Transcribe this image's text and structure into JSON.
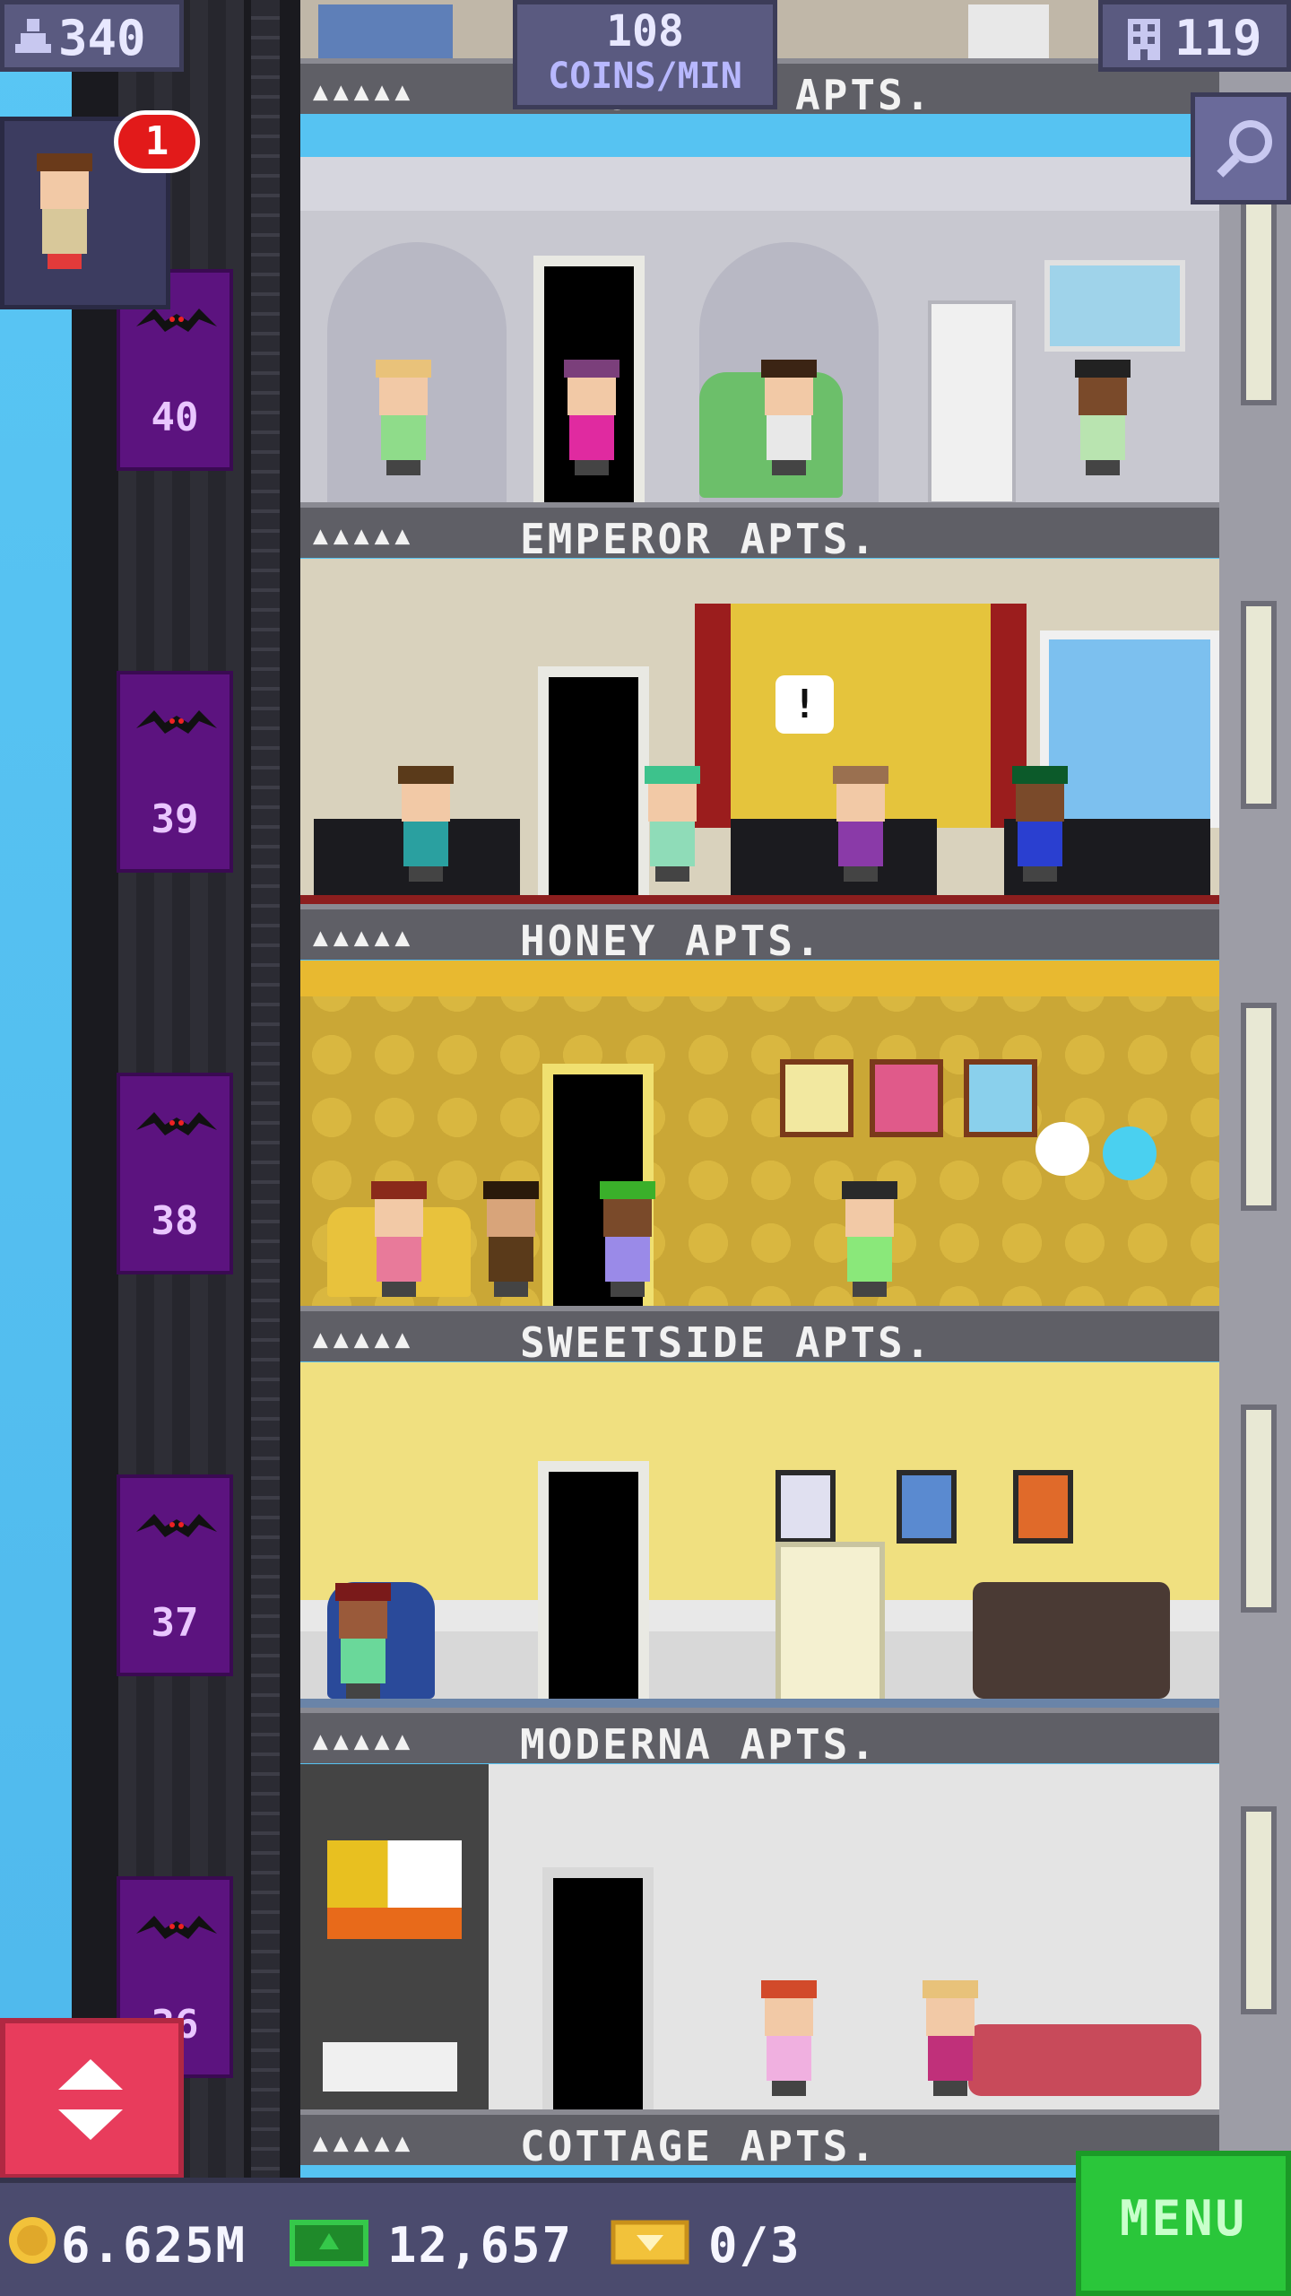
{
  "hud": {
    "population": "340",
    "coins_per_min_value": "108",
    "coins_per_min_label": "COINS/MIN",
    "floors_count": "119",
    "notification_count": "1"
  },
  "elevator_floors": [
    {
      "number": "40"
    },
    {
      "number": "39"
    },
    {
      "number": "38"
    },
    {
      "number": "37"
    },
    {
      "number": "36"
    }
  ],
  "floors": [
    {
      "name": "RIDGEMILL APTS.",
      "stars": "▲▲▲▲▲"
    },
    {
      "name": "EMPEROR APTS.",
      "stars": "▲▲▲▲▲"
    },
    {
      "name": "HONEY APTS.",
      "stars": "▲▲▲▲▲"
    },
    {
      "name": "SWEETSIDE APTS.",
      "stars": "▲▲▲▲▲"
    },
    {
      "name": "MODERNA APTS.",
      "stars": "▲▲▲▲▲"
    },
    {
      "name": "COTTAGE APTS.",
      "stars": "▲▲▲▲▲"
    }
  ],
  "bottom": {
    "coins": "6.625M",
    "bux": "12,657",
    "tickets": "0/3",
    "menu_label": "MENU"
  },
  "colors": {
    "hud_bg": "#5a5a80",
    "elevator_purple": "#5c137f",
    "menu_green": "#2ac63a",
    "elevator_button_red": "#e83c5c",
    "label_bar": "#5f5f66"
  },
  "icons": [
    "person-icon",
    "building-icon",
    "search-icon",
    "coin-icon",
    "bux-icon",
    "ticket-icon",
    "up-down-arrows-icon",
    "bat-icon"
  ]
}
